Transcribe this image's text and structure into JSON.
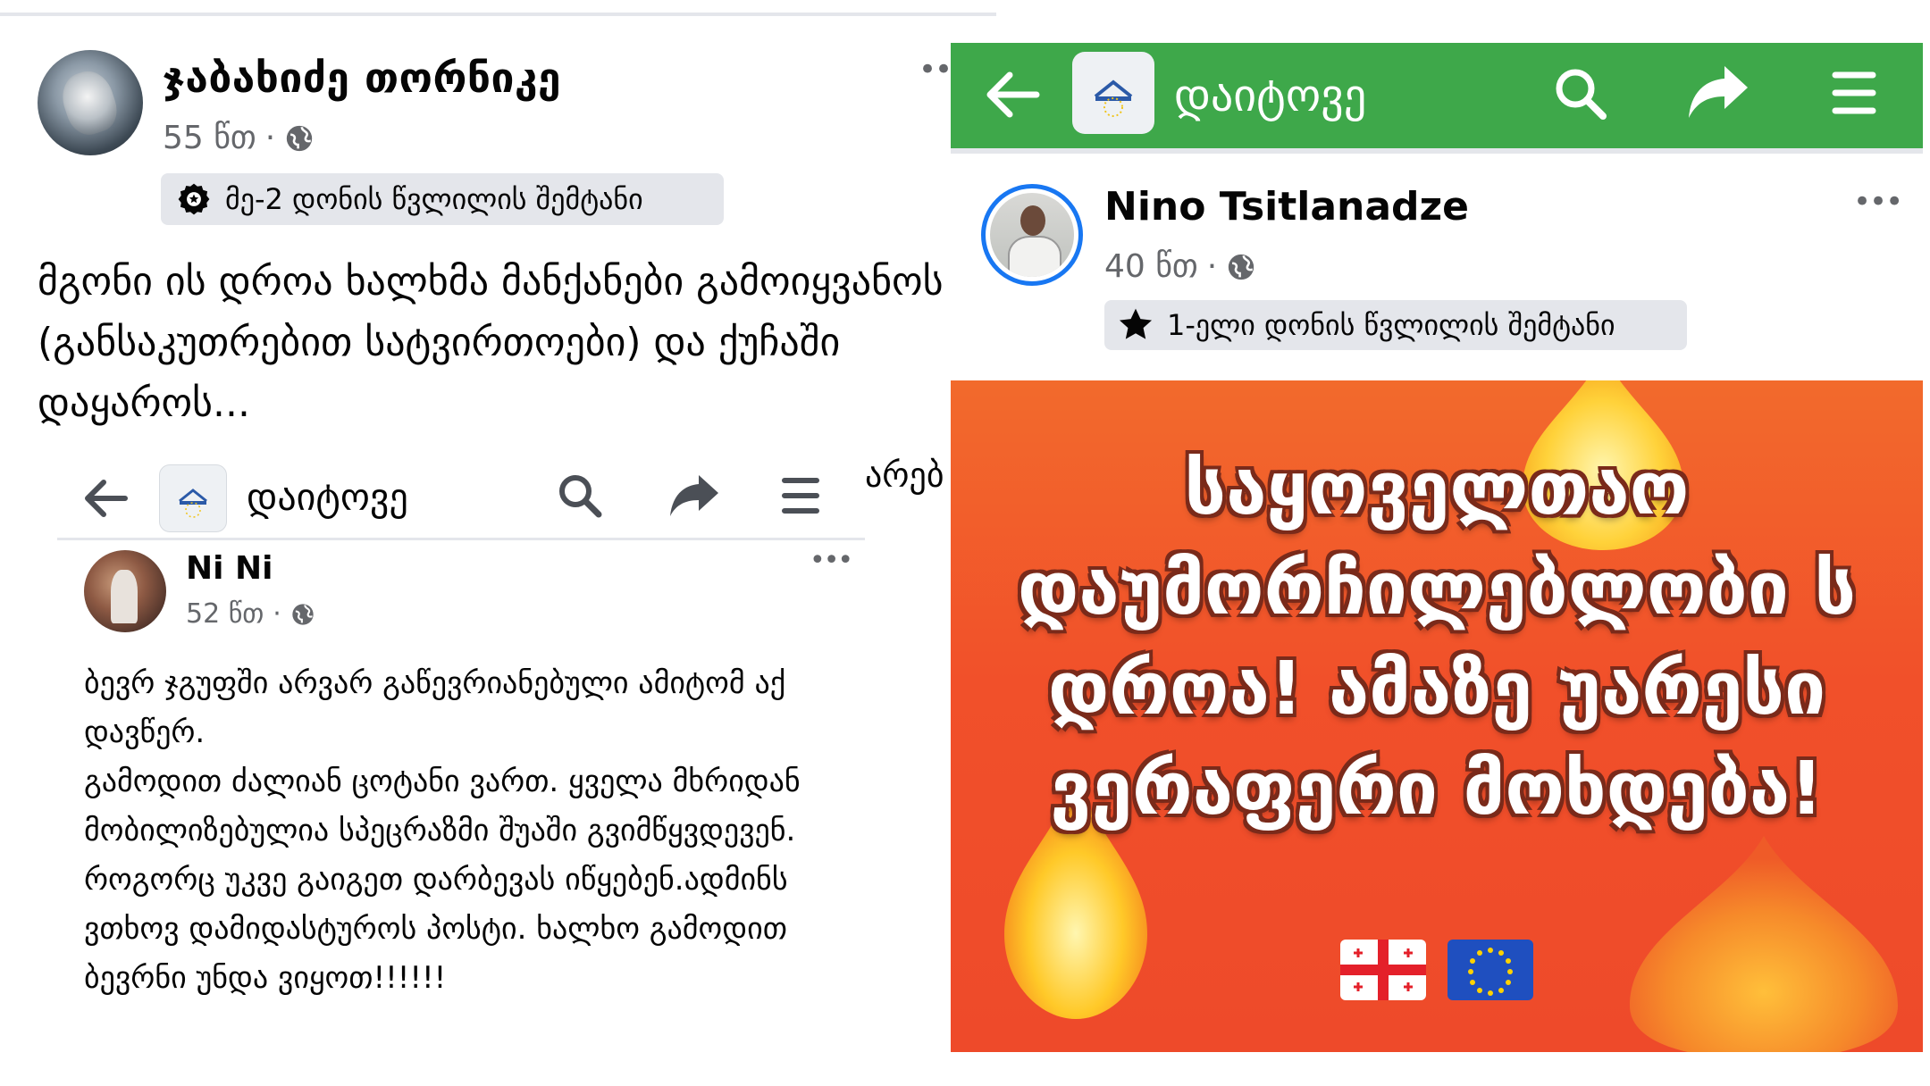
{
  "left_post": {
    "author": "ჯაბახიძე თორნიკე",
    "time": "55 წთ",
    "dot": "·",
    "more": "•••",
    "badge": "მე-2 დონის წვლილის შემტანი",
    "text": "მგონი ის დროა ხალხმა მანქანები გამოიყვანოს (განსაკუთრებით სატვირთოები) და ქუჩაში დაყაროს...",
    "overflow_text": "არებ"
  },
  "inset_post": {
    "group_title": "დაიტოვე",
    "author": "Ni Ni",
    "time": "52 წთ",
    "dot": "·",
    "more": "•••",
    "text": "ბევრ ჯგუფში არვარ გაწევრიანებული ამიტომ აქ დავწერ.\nგამოდით ძალიან ცოტანი ვართ. ყველა მხრიდან მობილიზებულია სპეცრაზმი შუაში გვიმწყვდევენ. როგორც უკვე გაიგეთ დარბევას იწყებენ.ადმინს ვთხოვ დამიდასტუროს პოსტი. ხალხო გამოდით ბევრნი უნდა ვიყოთ!!!!!!"
  },
  "right_post": {
    "group_title": "დაიტოვე",
    "author": "Nino Tsitlanadze",
    "time": "40 წთ",
    "dot": "·",
    "more": "•••",
    "badge": "1-ელი დონის წვლილის შემტანი",
    "poster_text": "საყოველთაო დაუმორჩილებლობი ს დროა! ამაზე უარესი ვერაფერი მოხდება!"
  },
  "icons": {
    "back": "back-arrow-icon",
    "search": "search-icon",
    "share": "share-icon",
    "menu": "menu-icon",
    "globe": "globe-icon",
    "badge_level2": "award-badge-icon",
    "badge_level1": "star-icon"
  },
  "colors": {
    "green_bar": "#3ea84a",
    "poster_bg": "#f1502a",
    "facebook_blue": "#1877f2",
    "meta_gray": "#65676b"
  }
}
